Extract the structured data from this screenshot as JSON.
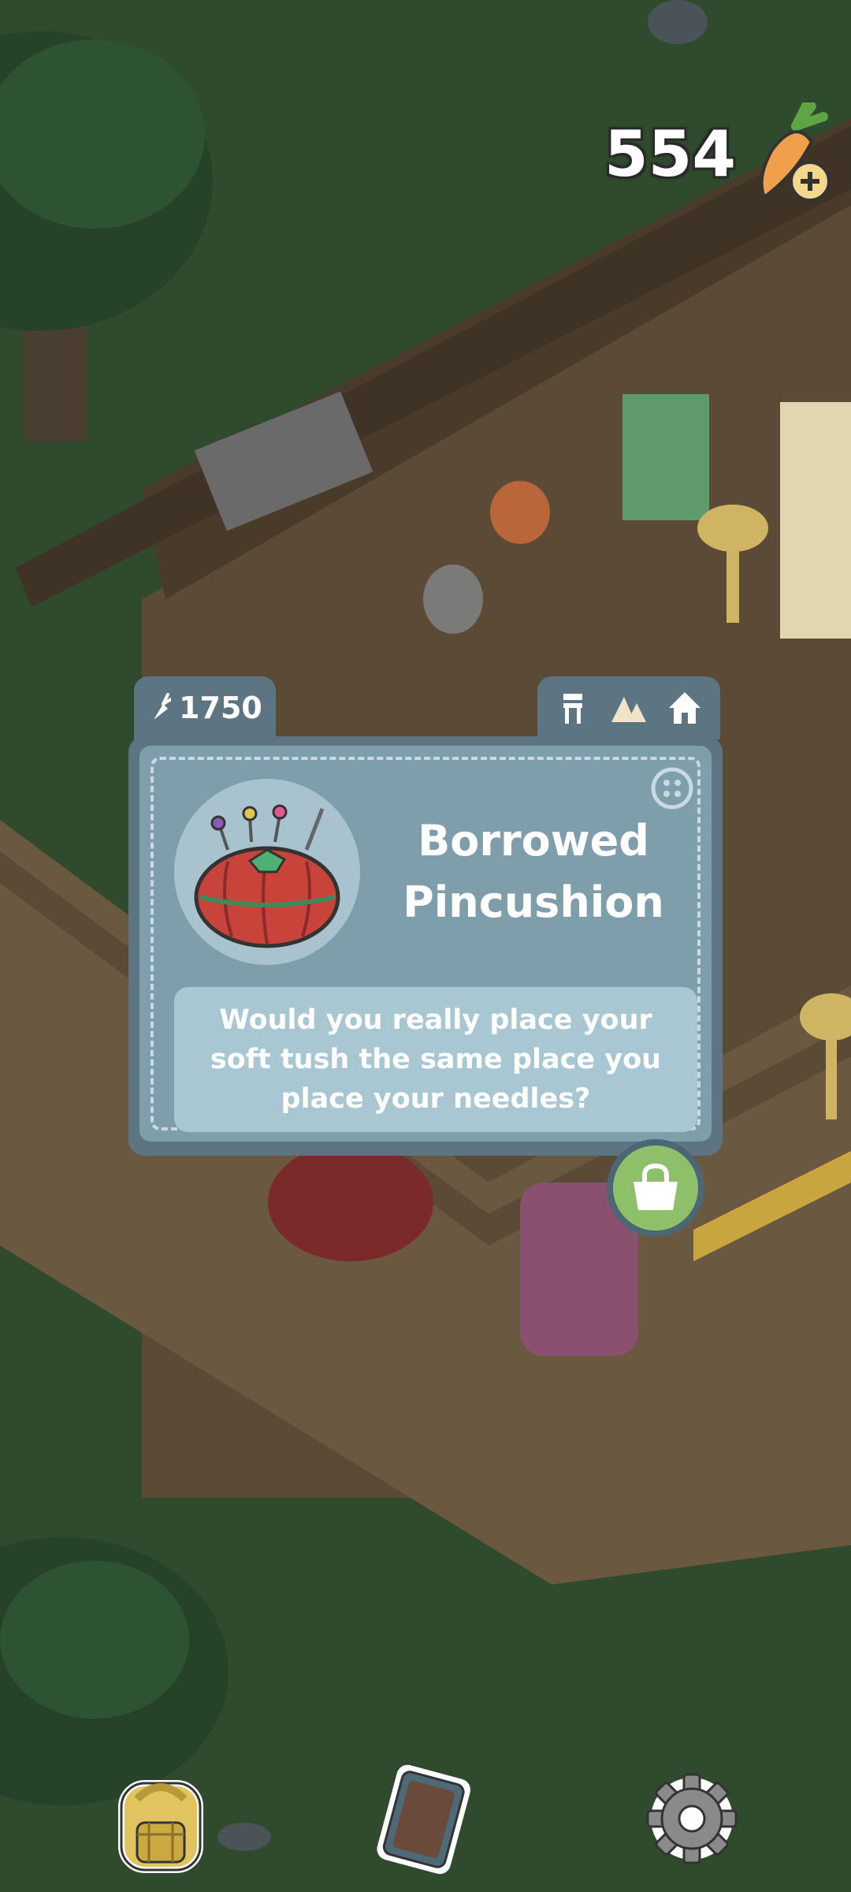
{
  "currency": {
    "value": "554",
    "icon": "carrot-plus-icon"
  },
  "item_card": {
    "cost": "1750",
    "cost_icon": "carrot-icon",
    "category_icons": [
      "stool-icon",
      "mountains-icon",
      "house-icon"
    ],
    "title": "Borrowed Pincushion",
    "description": "Would you really place your soft tush the same place you place your needles?",
    "item_icon": "pincushion-icon",
    "corner_icon": "button-icon"
  },
  "actions": {
    "buy_icon": "shopping-bag-icon"
  },
  "bottom_bar": {
    "items": [
      "backpack-icon",
      "tablet-icon",
      "gear-icon"
    ]
  },
  "colors": {
    "card": "#5d7482",
    "card_inner": "#7e9eac",
    "description_box": "#a8c7d3",
    "buy_button": "#8ec06a"
  }
}
